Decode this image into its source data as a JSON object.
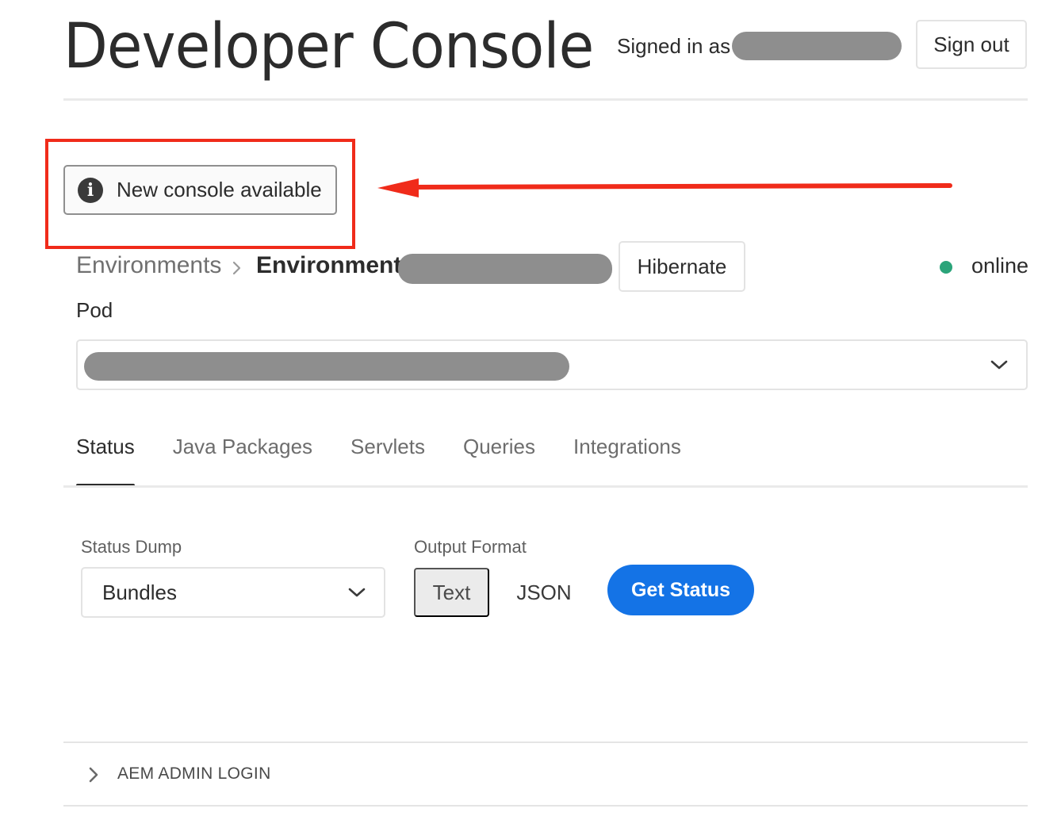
{
  "header": {
    "title": "Developer Console",
    "signed_in_prefix": "Signed in as",
    "sign_out_label": "Sign out"
  },
  "notice": {
    "label": "New console available",
    "icon": "info-icon"
  },
  "breadcrumb": {
    "root": "Environments",
    "current": "Environment",
    "separator_icon": "chevron-right-icon"
  },
  "environment": {
    "hibernate_label": "Hibernate",
    "status": "online",
    "status_color": "#2ba47a"
  },
  "pod": {
    "label": "Pod"
  },
  "tabs": [
    {
      "label": "Status",
      "active": true
    },
    {
      "label": "Java Packages",
      "active": false
    },
    {
      "label": "Servlets",
      "active": false
    },
    {
      "label": "Queries",
      "active": false
    },
    {
      "label": "Integrations",
      "active": false
    }
  ],
  "status_form": {
    "dump_label": "Status Dump",
    "dump_value": "Bundles",
    "format_label": "Output Format",
    "format_options": [
      "Text",
      "JSON"
    ],
    "format_selected": "Text",
    "submit_label": "Get Status"
  },
  "accordion": {
    "label": "AEM ADMIN LOGIN"
  },
  "colors": {
    "accent": "#1473e6",
    "annotation": "#f02b1a"
  }
}
